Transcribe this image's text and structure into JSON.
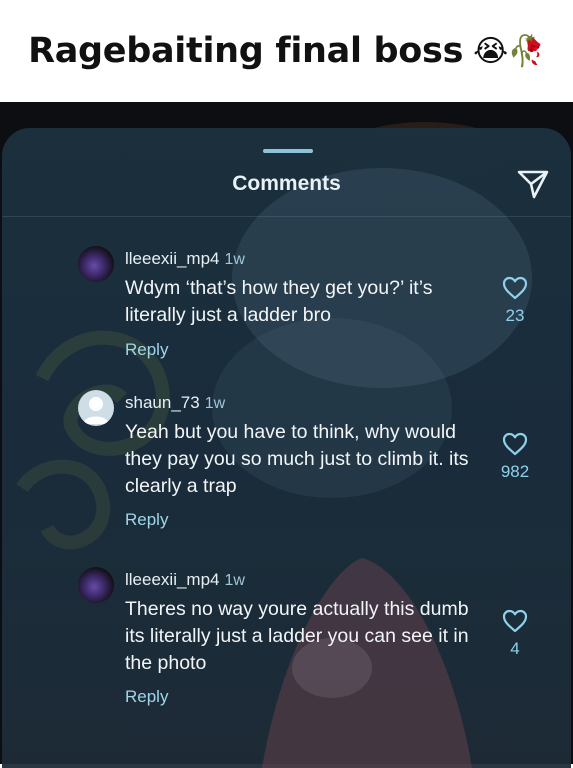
{
  "caption": {
    "text": "Ragebaiting final boss",
    "emoji": "😭🥀"
  },
  "panel": {
    "title": "Comments",
    "share_icon": "send-icon"
  },
  "comments": [
    {
      "username": "lleeexii_mp4",
      "time": "1w",
      "text": "Wdym ‘that’s how they get you?’ it’s literally just a ladder bro",
      "reply_label": "Reply",
      "likes": "23",
      "avatar": "photo"
    },
    {
      "username": "shaun_73",
      "time": "1w",
      "text": "Yeah but you have to think, why would they pay you so much just to climb it. its clearly a trap",
      "reply_label": "Reply",
      "likes": "982",
      "avatar": "default"
    },
    {
      "username": "lleeexii_mp4",
      "time": "1w",
      "text": "Theres no way youre actually this dumb its literally just a ladder you can see it in the photo",
      "reply_label": "Reply",
      "likes": "4",
      "avatar": "photo"
    }
  ],
  "colors": {
    "panel": "#1c303e",
    "accent": "#8fd0ea",
    "text": "#f2f5f7"
  }
}
